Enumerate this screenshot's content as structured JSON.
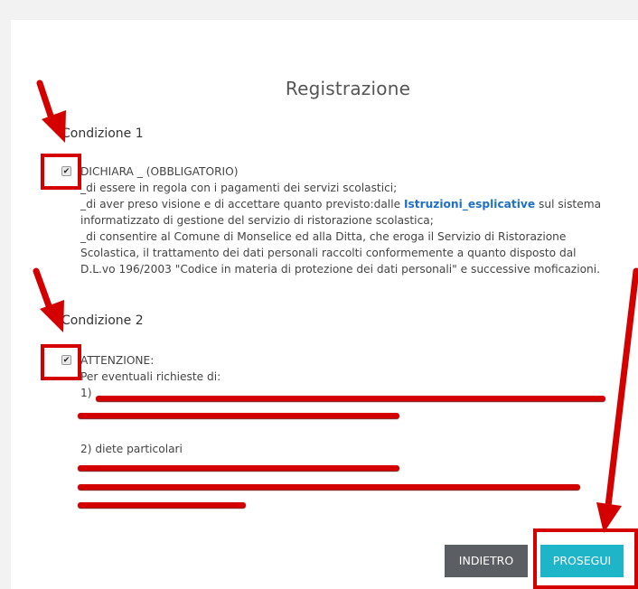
{
  "form": {
    "title": "Registrazione",
    "condition1": {
      "heading": "Condizione 1",
      "checked": true,
      "lines": [
        "DICHIARA _ (OBBLIGATORIO)",
        "_di essere in regola con i pagamenti dei servizi scolastici;",
        "informatizzato di gestione del servizio di ristorazione scolastica;",
        "_di consentire al Comune di Monselice ed alla Ditta, che eroga il Servizio di Ristorazione",
        "Scolastica, il trattamento dei dati personali raccolti conformemente a quanto disposto dal",
        "D.L.vo 196/2003 \"Codice in materia di protezione dei dati personali\" e successive moficazioni."
      ],
      "line_with_link_pre": "_di aver preso visione e di accettare quanto previsto:dalle ",
      "link_text": "Istruzioni_esplicative",
      "line_with_link_post": " sul sistema"
    },
    "condition2": {
      "heading": "Condizione 2",
      "checked": true,
      "lines": [
        "ATTENZIONE:",
        "Per eventuali richieste di:",
        "1)",
        "2) diete particolari"
      ]
    },
    "buttons": {
      "back": "INDIETRO",
      "next": "PROSEGUI"
    },
    "annotation_color": "#d40000",
    "accent_color": "#1fb5c9"
  }
}
